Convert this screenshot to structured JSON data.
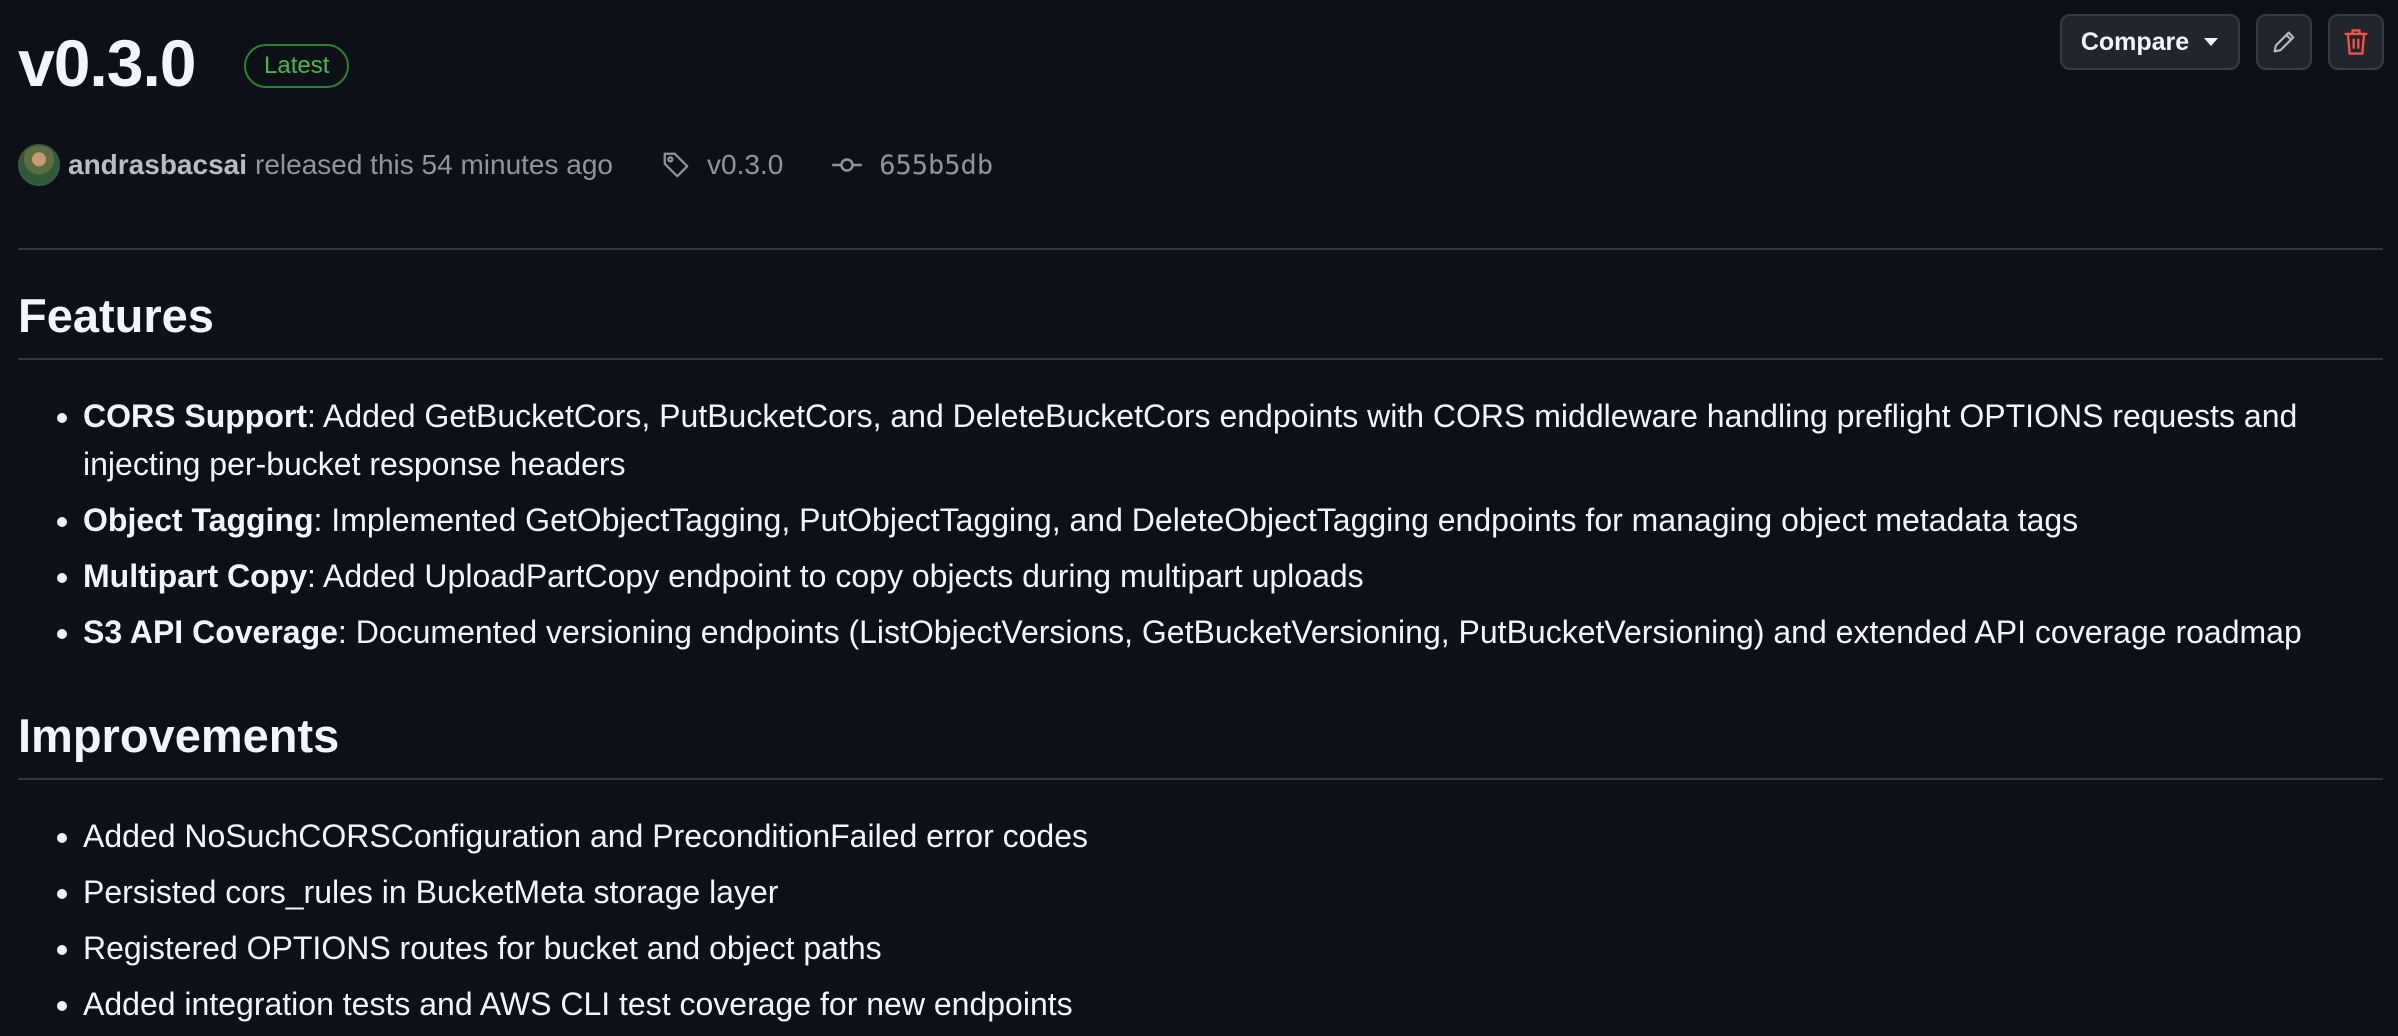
{
  "release": {
    "title": "v0.3.0",
    "badge": "Latest",
    "author": "andrasbacsai",
    "released_text": "released this 54 minutes ago",
    "tag": "v0.3.0",
    "commit": "655b5db"
  },
  "toolbar": {
    "compare_label": "Compare",
    "edit_icon": "pencil-icon",
    "delete_icon": "trash-icon",
    "delete_color": "#f85149"
  },
  "features": {
    "heading": "Features",
    "items": [
      {
        "title": "CORS Support",
        "text": ": Added GetBucketCors, PutBucketCors, and DeleteBucketCors endpoints with CORS middleware handling preflight OPTIONS requests and injecting per-bucket response headers"
      },
      {
        "title": "Object Tagging",
        "text": ": Implemented GetObjectTagging, PutObjectTagging, and DeleteObjectTagging endpoints for managing object metadata tags"
      },
      {
        "title": "Multipart Copy",
        "text": ": Added UploadPartCopy endpoint to copy objects during multipart uploads"
      },
      {
        "title": "S3 API Coverage",
        "text": ": Documented versioning endpoints (ListObjectVersions, GetBucketVersioning, PutBucketVersioning) and extended API coverage roadmap"
      }
    ]
  },
  "improvements": {
    "heading": "Improvements",
    "items": [
      "Added NoSuchCORSConfiguration and PreconditionFailed error codes",
      "Persisted cors_rules in BucketMeta storage layer",
      "Registered OPTIONS routes for bucket and object paths",
      "Added integration tests and AWS CLI test coverage for new endpoints"
    ]
  },
  "colors": {
    "background": "#0d1117",
    "badge_green": "#3fb950",
    "text": "#f0f6fc",
    "muted": "#8d96a0"
  }
}
